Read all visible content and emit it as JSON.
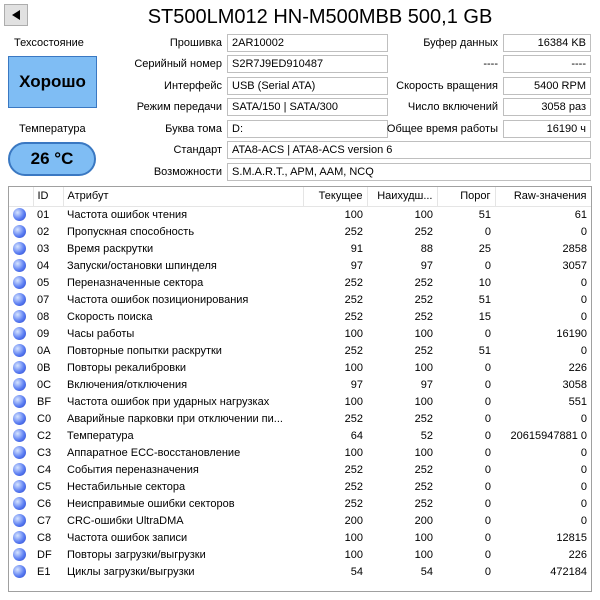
{
  "title": "ST500LM012 HN-M500MBB 500,1 GB",
  "health": {
    "label": "Техсостояние",
    "value": "Хорошо"
  },
  "temperature": {
    "label": "Температура",
    "value": "26 °C"
  },
  "info": {
    "firmware": {
      "label": "Прошивка",
      "value": "2AR10002"
    },
    "serial": {
      "label": "Серийный номер",
      "value": "S2R7J9ED910487"
    },
    "interface": {
      "label": "Интерфейс",
      "value": "USB (Serial ATA)"
    },
    "transfer": {
      "label": "Режим передачи",
      "value": "SATA/150 | SATA/300"
    },
    "volume": {
      "label": "Буква тома",
      "value": "D:"
    },
    "standard": {
      "label": "Стандарт",
      "value": "ATA8-ACS | ATA8-ACS version 6"
    },
    "features": {
      "label": "Возможности",
      "value": "S.M.A.R.T., APM, AAM, NCQ"
    },
    "buffer": {
      "label": "Буфер данных",
      "value": "16384 KB"
    },
    "blank1": {
      "label": "----",
      "value": "----"
    },
    "rotation": {
      "label": "Скорость вращения",
      "value": "5400 RPM"
    },
    "power_count": {
      "label": "Число включений",
      "value": "3058 раз"
    },
    "power_hours": {
      "label": "Общее время работы",
      "value": "16190 ч"
    }
  },
  "table": {
    "headers": [
      "",
      "ID",
      "Атрибут",
      "Текущее",
      "Наихудш...",
      "Порог",
      "Raw-значения"
    ],
    "rows": [
      [
        "01",
        "Частота ошибок чтения",
        "100",
        "100",
        "51",
        "61"
      ],
      [
        "02",
        "Пропускная способность",
        "252",
        "252",
        "0",
        "0"
      ],
      [
        "03",
        "Время раскрутки",
        "91",
        "88",
        "25",
        "2858"
      ],
      [
        "04",
        "Запуски/остановки шпинделя",
        "97",
        "97",
        "0",
        "3057"
      ],
      [
        "05",
        "Переназначенные сектора",
        "252",
        "252",
        "10",
        "0"
      ],
      [
        "07",
        "Частота ошибок позиционирования",
        "252",
        "252",
        "51",
        "0"
      ],
      [
        "08",
        "Скорость поиска",
        "252",
        "252",
        "15",
        "0"
      ],
      [
        "09",
        "Часы работы",
        "100",
        "100",
        "0",
        "16190"
      ],
      [
        "0A",
        "Повторные попытки раскрутки",
        "252",
        "252",
        "51",
        "0"
      ],
      [
        "0B",
        "Повторы рекалибровки",
        "100",
        "100",
        "0",
        "226"
      ],
      [
        "0C",
        "Включения/отключения",
        "97",
        "97",
        "0",
        "3058"
      ],
      [
        "BF",
        "Частота ошибок при ударных нагрузках",
        "100",
        "100",
        "0",
        "551"
      ],
      [
        "C0",
        "Аварийные парковки при отключении пи...",
        "252",
        "252",
        "0",
        "0"
      ],
      [
        "C2",
        "Температура",
        "64",
        "52",
        "0",
        "20615947881 0"
      ],
      [
        "C3",
        "Аппаратное ECC-восстановление",
        "100",
        "100",
        "0",
        "0"
      ],
      [
        "C4",
        "События переназначения",
        "252",
        "252",
        "0",
        "0"
      ],
      [
        "C5",
        "Нестабильные сектора",
        "252",
        "252",
        "0",
        "0"
      ],
      [
        "C6",
        "Неисправимые ошибки секторов",
        "252",
        "252",
        "0",
        "0"
      ],
      [
        "C7",
        "CRC-ошибки UltraDMA",
        "200",
        "200",
        "0",
        "0"
      ],
      [
        "C8",
        "Частота ошибок записи",
        "100",
        "100",
        "0",
        "12815"
      ],
      [
        "DF",
        "Повторы загрузки/выгрузки",
        "100",
        "100",
        "0",
        "226"
      ],
      [
        "E1",
        "Циклы загрузки/выгрузки",
        "54",
        "54",
        "0",
        "472184"
      ]
    ]
  },
  "colors": {
    "health_fill": "#7fbdf4",
    "health_border": "#3a78c2",
    "status_dot": "#4a6cf0"
  }
}
